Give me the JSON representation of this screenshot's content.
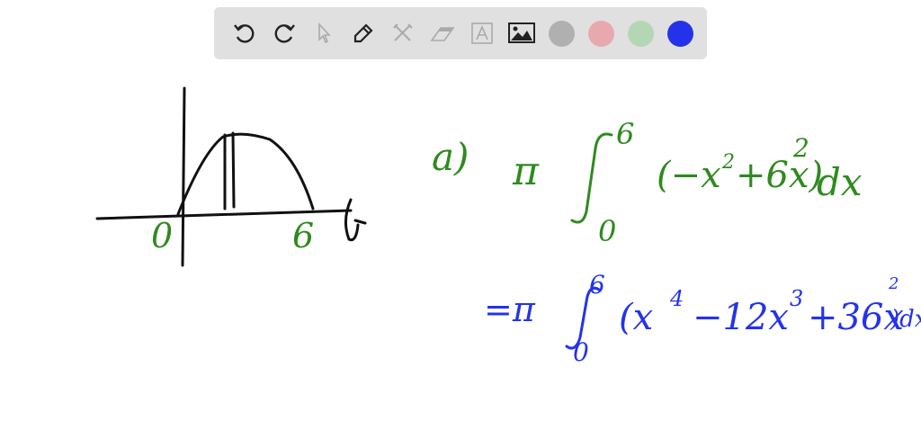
{
  "toolbar": {
    "tools": [
      "undo",
      "redo",
      "select",
      "pen",
      "tools",
      "eraser",
      "text",
      "image"
    ],
    "colors": [
      "#b0b0b0",
      "#e8a9ae",
      "#b4d6b4",
      "#2433ea"
    ]
  },
  "board": {
    "graph_labels": {
      "origin": "0",
      "right": "6",
      "axis": "x"
    },
    "part": "a)",
    "line1": {
      "pi": "π",
      "upper": "6",
      "lower": "0",
      "integrand": "(−x",
      "sq": "2",
      "rest": "+6x)",
      "outer": "2",
      "dx": "dx"
    },
    "line2": {
      "eq": "=π",
      "upper": "6",
      "lower": "0",
      "integrand": "(x",
      "p4": "4",
      "mid": "−12x",
      "p3": "3",
      "end": "+36x",
      "p2": "2",
      "close": ")dx"
    },
    "green": "#2f8a1f",
    "blue": "#2433ea"
  }
}
